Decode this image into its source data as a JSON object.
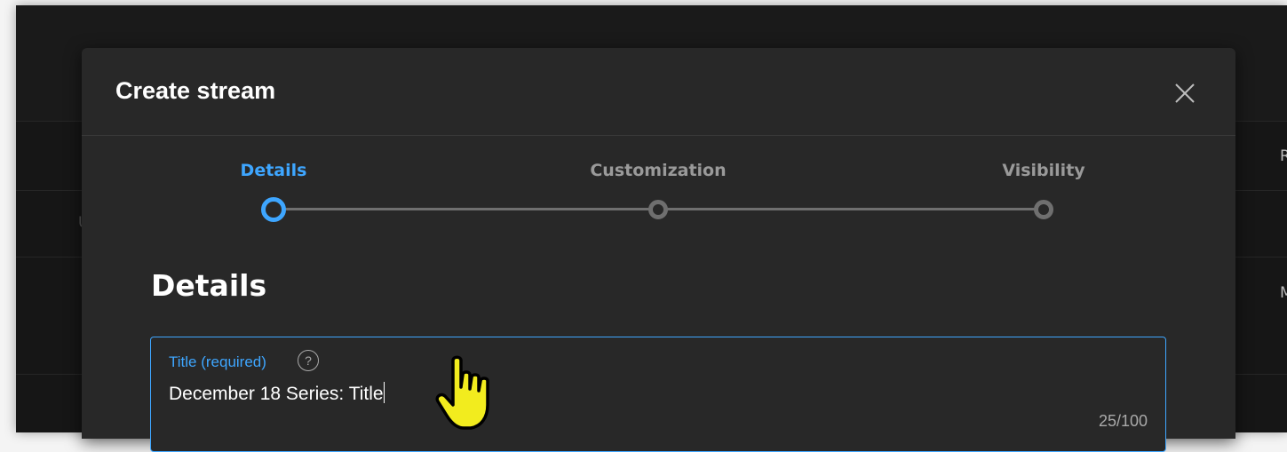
{
  "dialog": {
    "title": "Create stream",
    "close_icon": "close-icon"
  },
  "stepper": {
    "steps": [
      {
        "label": "Details",
        "state": "active"
      },
      {
        "label": "Customization",
        "state": "inactive"
      },
      {
        "label": "Visibility",
        "state": "inactive"
      }
    ]
  },
  "details": {
    "heading": "Details",
    "title_field": {
      "label": "Title (required)",
      "help_icon": "help-circle-icon",
      "value": "December 18 Series: Title",
      "char_count": "25/100"
    }
  },
  "background": {
    "right_letters": [
      "R",
      "M"
    ],
    "left_letter": "U"
  },
  "cursor": "hand-pointer-icon",
  "colors": {
    "accent": "#3ea6ff",
    "dialog_bg": "#282828",
    "page_bg": "#161616",
    "cursor_fill": "#f2ec1e"
  }
}
